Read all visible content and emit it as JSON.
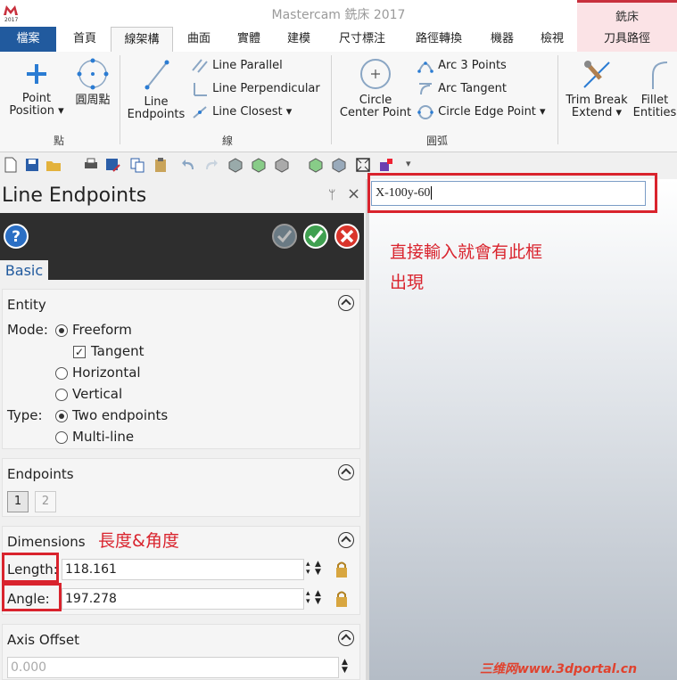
{
  "app": {
    "title": "Mastercam 銑床 2017",
    "context_tab": "銑床",
    "logo_year": "2017"
  },
  "tabs": [
    "檔案",
    "首頁",
    "線架構",
    "曲面",
    "實體",
    "建模",
    "尺寸標注",
    "路徑轉換",
    "機器",
    "檢視",
    "刀具路徑"
  ],
  "ribbon": {
    "point_position": [
      "Point",
      "Position"
    ],
    "circle_point": "圓周點",
    "line_endpoints": [
      "Line",
      "Endpoints"
    ],
    "line_parallel": "Line Parallel",
    "line_perpendicular": "Line Perpendicular",
    "line_closest": "Line Closest",
    "circle_center_point": [
      "Circle",
      "Center Point"
    ],
    "arc_3_points": "Arc 3 Points",
    "arc_tangent": "Arc Tangent",
    "circle_edge_point": "Circle Edge Point",
    "trim_break_extend": [
      "Trim Break",
      "Extend"
    ],
    "fillet_entities": [
      "Fillet",
      "Entities"
    ],
    "group_points": "點",
    "group_lines": "線",
    "group_arcs": "圓弧"
  },
  "panel": {
    "title": "Line Endpoints",
    "pin": "ᛘ",
    "close": "×",
    "basic_tab": "Basic",
    "entity": {
      "title": "Entity",
      "mode_label": "Mode:",
      "freeform": "Freeform",
      "tangent": "Tangent",
      "horizontal": "Horizontal",
      "vertical": "Vertical",
      "type_label": "Type:",
      "two_endpoints": "Two endpoints",
      "multi_line": "Multi-line"
    },
    "endpoints": {
      "title": "Endpoints",
      "btn1": "1",
      "btn2": "2"
    },
    "dimensions": {
      "title": "Dimensions",
      "length_label": "Length:",
      "length_value": "118.161",
      "angle_label": "Angle:",
      "angle_value": "197.278"
    },
    "axis_offset": {
      "title": "Axis Offset",
      "value": "0.000"
    }
  },
  "canvas": {
    "input_value": "X-100y-60",
    "annotation": "直接輸入就會有此框\n出現"
  },
  "annotations": {
    "dimensions_note": "長度&角度",
    "watermark": "三维网www.3dportal.cn"
  },
  "colors": {
    "file_tab": "#215a9e",
    "annotation_red": "#d9232d",
    "context_pink": "#fbe3e6"
  }
}
